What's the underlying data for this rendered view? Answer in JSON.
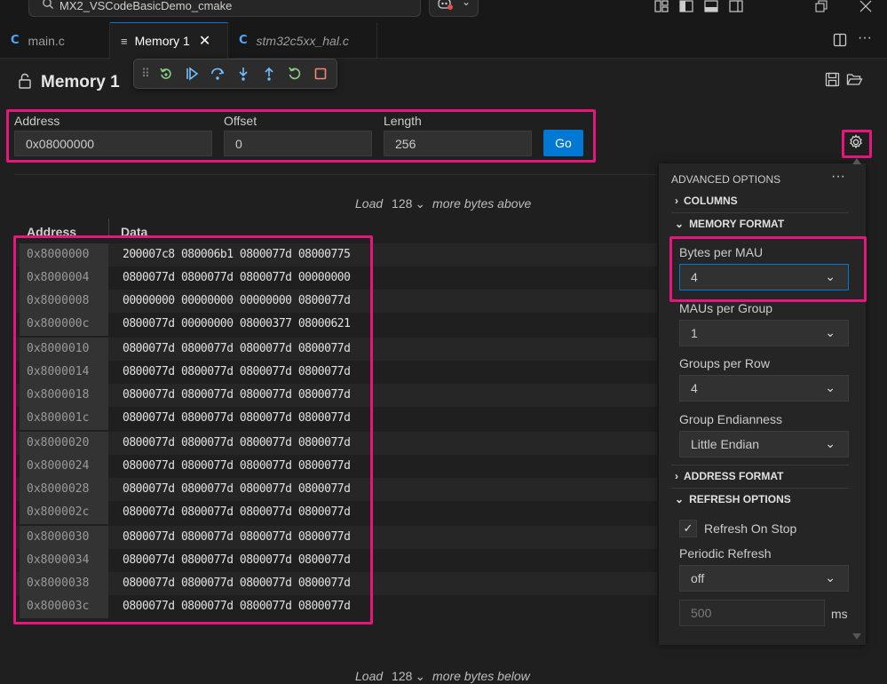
{
  "window": {
    "search_text": "MX2_VSCodeBasicDemo_cmake"
  },
  "tabs": [
    {
      "icon": "C",
      "label": "main.c"
    },
    {
      "icon": "≡",
      "label": "Memory 1",
      "close": "✕"
    },
    {
      "icon": "C",
      "label": "stm32c5xx_hal.c"
    }
  ],
  "memory": {
    "title": "Memory 1",
    "address_label": "Address",
    "address_value": "0x08000000",
    "offset_label": "Offset",
    "offset_value": "0",
    "length_label": "Length",
    "length_value": "256",
    "go_label": "Go"
  },
  "load_above": {
    "prefix": "Load",
    "count": "128",
    "suffix": "more bytes above"
  },
  "load_below": {
    "prefix": "Load",
    "count": "128",
    "suffix": "more bytes below"
  },
  "table": {
    "header_address": "Address",
    "header_data": "Data",
    "rows": [
      {
        "addr": "0x8000000",
        "data": "200007c8 080006b1 0800077d 08000775"
      },
      {
        "addr": "0x8000004",
        "data": "0800077d 0800077d 0800077d 00000000"
      },
      {
        "addr": "0x8000008",
        "data": "00000000 00000000 00000000 0800077d"
      },
      {
        "addr": "0x800000c",
        "data": "0800077d 00000000 08000377 08000621"
      },
      {
        "addr": "0x8000010",
        "data": "0800077d 0800077d 0800077d 0800077d"
      },
      {
        "addr": "0x8000014",
        "data": "0800077d 0800077d 0800077d 0800077d"
      },
      {
        "addr": "0x8000018",
        "data": "0800077d 0800077d 0800077d 0800077d"
      },
      {
        "addr": "0x800001c",
        "data": "0800077d 0800077d 0800077d 0800077d"
      },
      {
        "addr": "0x8000020",
        "data": "0800077d 0800077d 0800077d 0800077d"
      },
      {
        "addr": "0x8000024",
        "data": "0800077d 0800077d 0800077d 0800077d"
      },
      {
        "addr": "0x8000028",
        "data": "0800077d 0800077d 0800077d 0800077d"
      },
      {
        "addr": "0x800002c",
        "data": "0800077d 0800077d 0800077d 0800077d"
      },
      {
        "addr": "0x8000030",
        "data": "0800077d 0800077d 0800077d 0800077d"
      },
      {
        "addr": "0x8000034",
        "data": "0800077d 0800077d 0800077d 0800077d"
      },
      {
        "addr": "0x8000038",
        "data": "0800077d 0800077d 0800077d 0800077d"
      },
      {
        "addr": "0x800003c",
        "data": "0800077d 0800077d 0800077d 0800077d"
      }
    ]
  },
  "advanced": {
    "title": "ADVANCED OPTIONS",
    "more": "···",
    "columns": "COLUMNS",
    "memory_format": "MEMORY FORMAT",
    "bytes_per_mau_label": "Bytes per MAU",
    "bytes_per_mau_value": "4",
    "maus_per_group_label": "MAUs per Group",
    "maus_per_group_value": "1",
    "groups_per_row_label": "Groups per Row",
    "groups_per_row_value": "4",
    "group_endianness_label": "Group Endianness",
    "group_endianness_value": "Little Endian",
    "address_format": "ADDRESS FORMAT",
    "refresh_options": "REFRESH OPTIONS",
    "refresh_on_stop_label": "Refresh On Stop",
    "refresh_on_stop_checked": true,
    "periodic_refresh_label": "Periodic Refresh",
    "periodic_refresh_value": "off",
    "interval_placeholder": "500",
    "interval_unit": "ms"
  },
  "colors": {
    "highlight": "#e5177f",
    "accent": "#0078d4"
  },
  "icons": [
    "search-icon",
    "copilot-icon",
    "layout-icon",
    "sidebar-toggle-icon",
    "panel-toggle-icon",
    "secondary-sidebar-icon",
    "restore-icon",
    "close-icon",
    "split-editor-icon",
    "more-icon",
    "lock-icon",
    "gripper-icon",
    "restart-icon",
    "continue-icon",
    "step-over-icon",
    "step-into-icon",
    "step-out-icon",
    "reset-icon",
    "stop-icon",
    "save-icon",
    "open-folder-icon",
    "gear-icon",
    "chevron-down-icon",
    "chevron-right-icon",
    "check-icon"
  ]
}
